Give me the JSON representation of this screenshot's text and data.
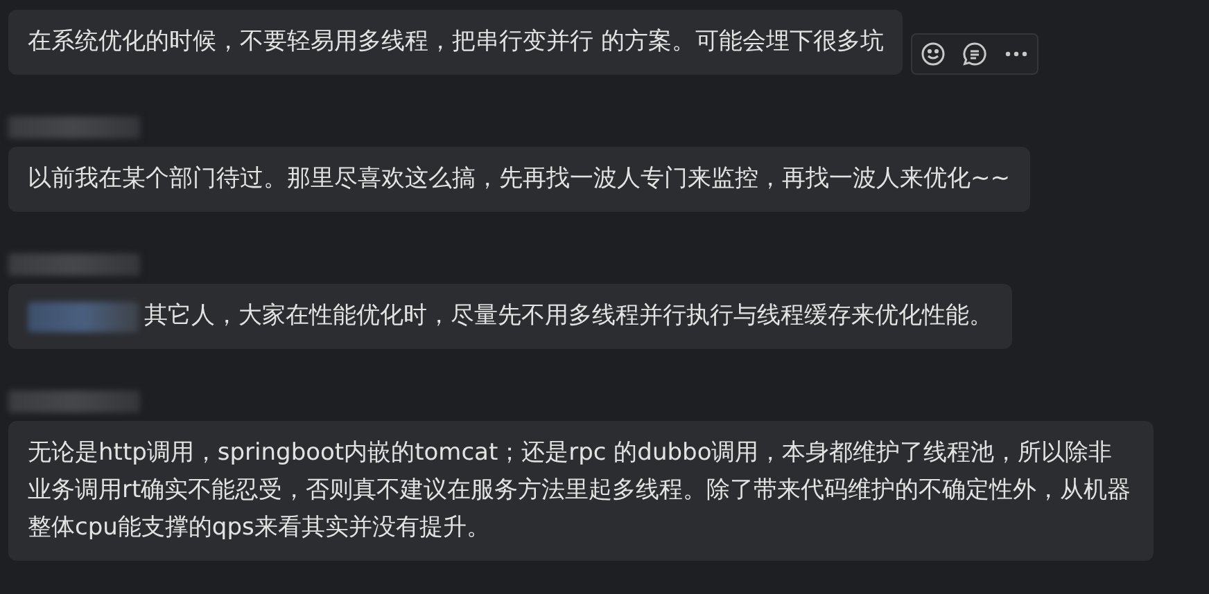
{
  "messages": [
    {
      "sender_blurred": false,
      "mention_blurred": false,
      "actions": true,
      "text": "在系统优化的时候，不要轻易用多线程，把串行变并行 的方案。可能会埋下很多坑"
    },
    {
      "sender_blurred": true,
      "mention_blurred": false,
      "actions": false,
      "text": "以前我在某个部门待过。那里尽喜欢这么搞，先再找一波人专门来监控，再找一波人来优化~~"
    },
    {
      "sender_blurred": true,
      "mention_blurred": true,
      "actions": false,
      "text": "其它人，大家在性能优化时，尽量先不用多线程并行执行与线程缓存来优化性能。"
    },
    {
      "sender_blurred": true,
      "mention_blurred": false,
      "actions": false,
      "text": "无论是http调用，springboot内嵌的tomcat；还是rpc 的dubbo调用，本身都维护了线程池，所以除非业务调用rt确实不能忍受，否则真不建议在服务方法里起多线程。除了带来代码维护的不确定性外，从机器整体cpu能支撑的qps来看其实并没有提升。"
    }
  ]
}
